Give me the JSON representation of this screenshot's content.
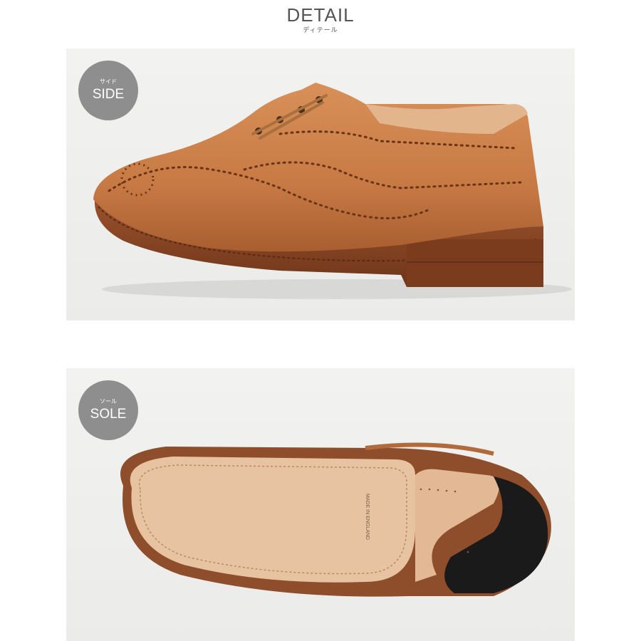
{
  "header": {
    "title": "DETAIL",
    "subtitle": "ディテール"
  },
  "panels": [
    {
      "badge_jp": "サイド",
      "badge_en": "SIDE"
    },
    {
      "badge_jp": "ソール",
      "badge_en": "SOLE",
      "sole_stamp": "MADE IN ENGLAND"
    }
  ],
  "colors": {
    "badge": "#8e8e8e",
    "leather": "#c87a45",
    "sole_welt": "#8a4a28",
    "sole_leather": "#e8c3a2",
    "heel_rubber": "#1a1a1a"
  }
}
